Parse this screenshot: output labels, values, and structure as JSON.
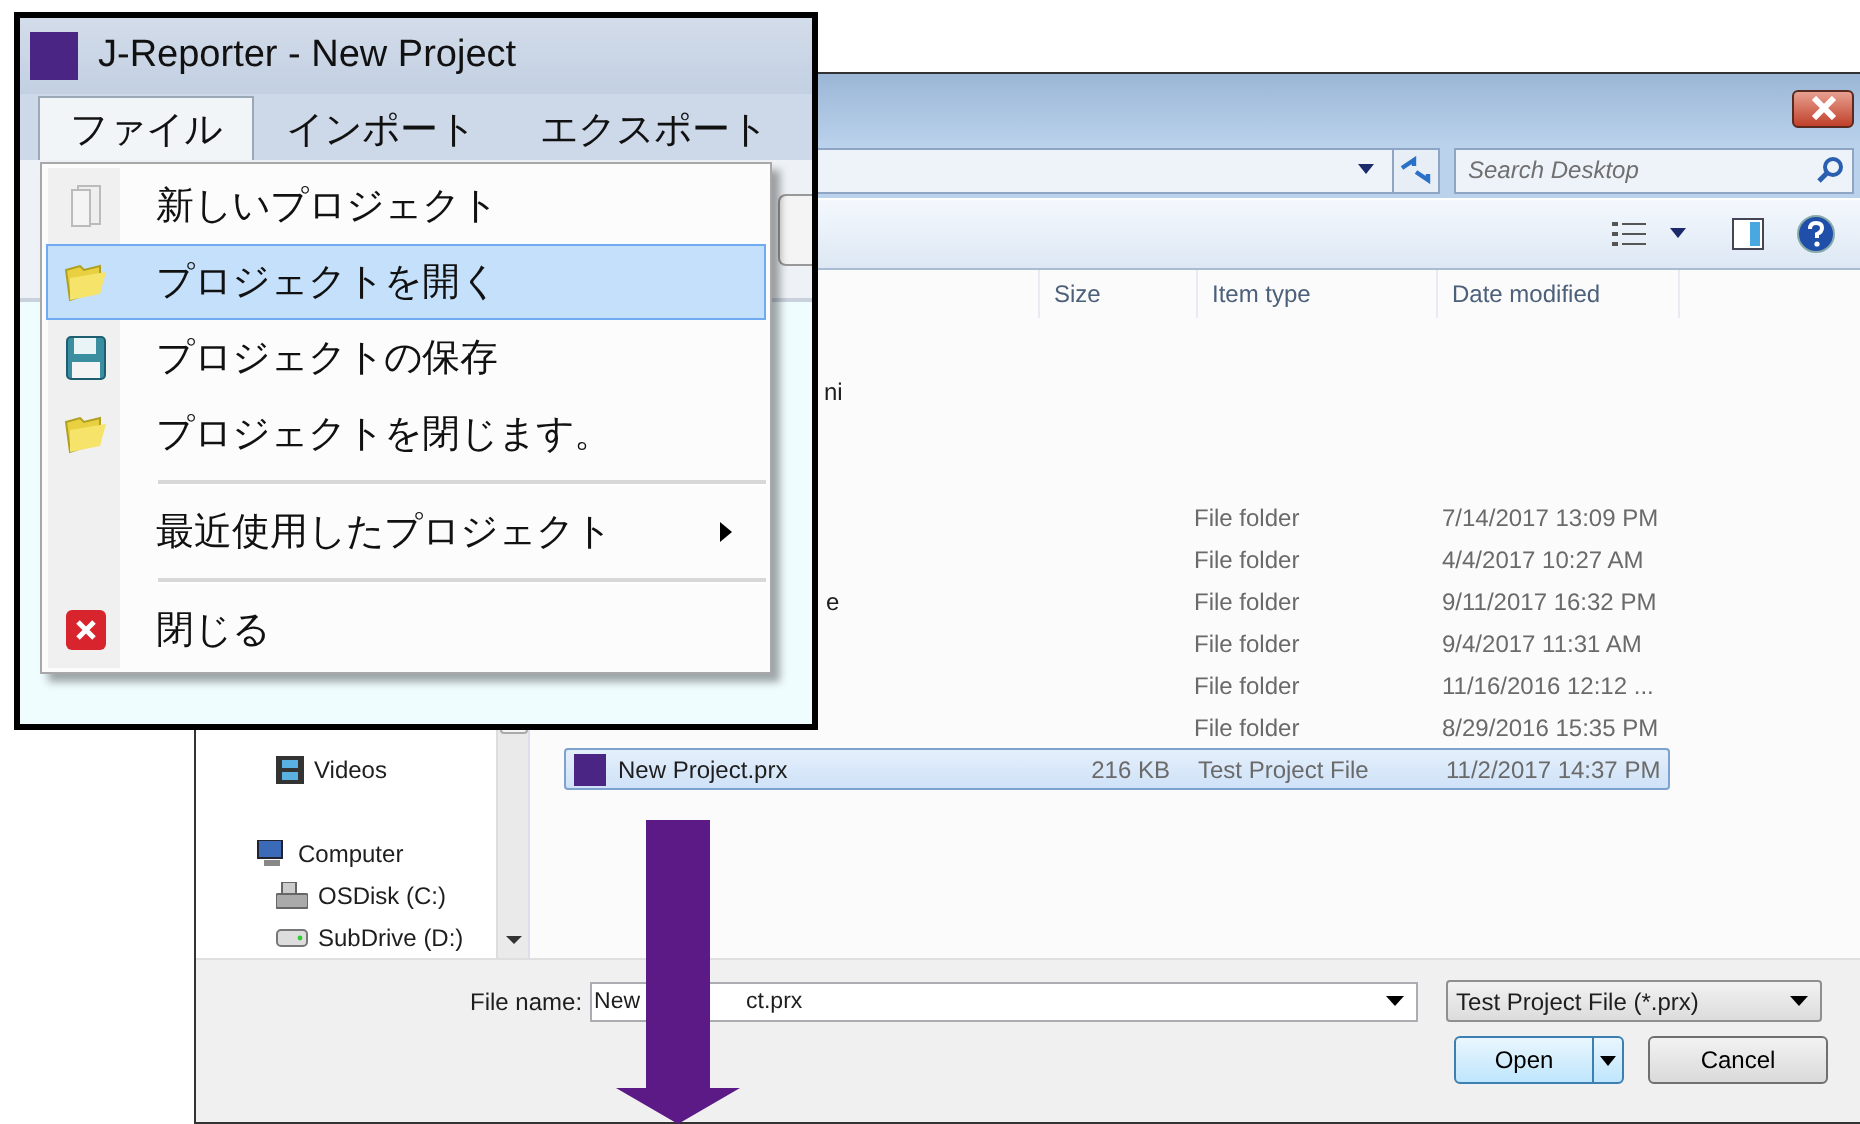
{
  "app_window": {
    "title": "J-Reporter - New Project",
    "menus": [
      {
        "label": "ファイル",
        "selected": true
      },
      {
        "label": "インポート",
        "selected": false
      },
      {
        "label": "エクスポート",
        "selected": false
      }
    ],
    "file_menu": [
      {
        "kind": "item",
        "label": "新しいプロジェクト",
        "selected": false
      },
      {
        "kind": "item",
        "label": "プロジェクトを開く",
        "selected": true
      },
      {
        "kind": "item",
        "label": "プロジェクトの保存",
        "selected": false
      },
      {
        "kind": "item",
        "label": "プロジェクトを閉じます。",
        "selected": false
      },
      {
        "kind": "separator"
      },
      {
        "kind": "submenu",
        "label": "最近使用したプロジェクト",
        "selected": false
      },
      {
        "kind": "separator"
      },
      {
        "kind": "item",
        "label": "閉じる",
        "selected": false
      }
    ]
  },
  "open_dialog": {
    "search": {
      "placeholder": "Search Desktop"
    },
    "columns": [
      "Size",
      "Item type",
      "Date modified"
    ],
    "partial_item": "ni",
    "rows": [
      {
        "kind": "folder",
        "type": "File folder",
        "modified": "7/14/2017 13:09 PM",
        "selected": false
      },
      {
        "kind": "folder",
        "type": "File folder",
        "modified": "4/4/2017 10:27 AM",
        "selected": false
      },
      {
        "kind": "folder",
        "name": "e",
        "type": "File folder",
        "modified": "9/11/2017 16:32 PM",
        "selected": false
      },
      {
        "kind": "folder",
        "type": "File folder",
        "modified": "9/4/2017 11:31 AM",
        "selected": false
      },
      {
        "kind": "folder",
        "type": "File folder",
        "modified": "11/16/2016 12:12 ...",
        "selected": false
      },
      {
        "kind": "folder",
        "type": "File folder",
        "modified": "8/29/2016 15:35 PM",
        "selected": false
      },
      {
        "kind": "project",
        "name": "New Project.prx",
        "size": "216 KB",
        "type": "Test Project File",
        "modified": "11/2/2017 14:37 PM",
        "selected": true
      }
    ],
    "library_items": [
      "Videos"
    ],
    "computer": {
      "label": "Computer",
      "children": [
        "OSDisk (C:)",
        "SubDrive (D:)"
      ]
    },
    "file_name": {
      "label": "File name:",
      "value_parts": [
        "New",
        "ct.prx"
      ]
    },
    "file_type": "Test Project File (*.prx)",
    "buttons": [
      {
        "kind": "split",
        "label": "Open"
      },
      {
        "kind": "plain",
        "label": "Cancel"
      }
    ]
  }
}
